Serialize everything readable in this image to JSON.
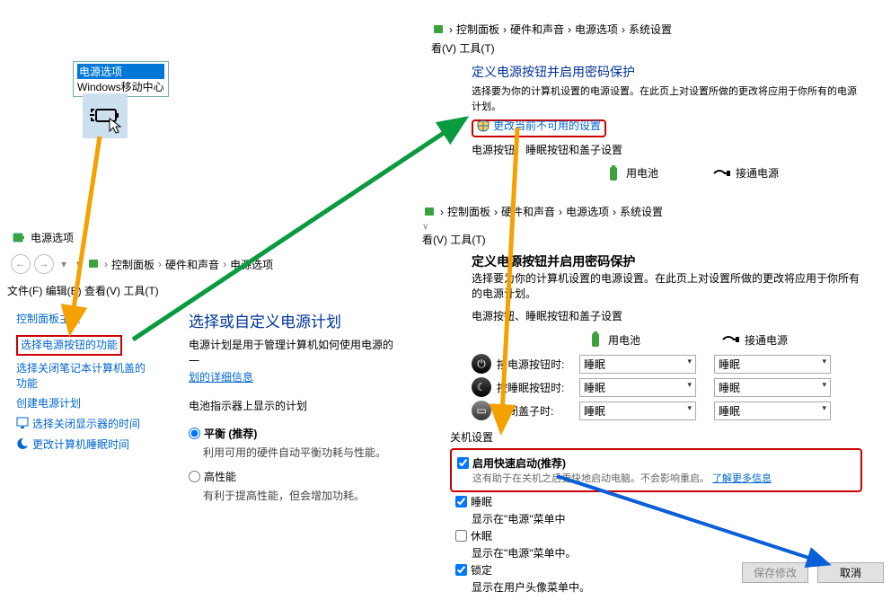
{
  "tl_menu": {
    "item1": "电源选项",
    "item2": "Windows移动中心"
  },
  "left": {
    "iconrow_label": "电源选项",
    "breadcrumb": [
      "控制面板",
      "硬件和声音",
      "电源选项"
    ],
    "menus": "文件(F)  编辑(E)  查看(V)  工具(T)",
    "sidebar": {
      "home": "控制面板主页",
      "links": [
        "选择电源按钮的功能",
        "选择关闭笔记本计算机盖的功能",
        "创建电源计划",
        "选择关闭显示器的时间",
        "更改计算机睡眠时间"
      ]
    },
    "main": {
      "title": "选择或自定义电源计划",
      "desc": "电源计划是用于管理计算机如何使用电源的一",
      "desc_link": "划的详细信息",
      "indicator_label": "电池指示器上显示的计划",
      "balanced": "平衡 (推荐)",
      "balanced_desc": "利用可用的硬件自动平衡功耗与性能。",
      "highperf": "高性能",
      "highperf_desc": "有利于提高性能，但会增加功耗。"
    }
  },
  "rt": {
    "breadcrumb": [
      "控制面板",
      "硬件和声音",
      "电源选项",
      "系统设置"
    ],
    "menus": "看(V)  工具(T)",
    "title": "定义电源按钮并启用密码保护",
    "desc": "选择要为你的计算机设置的电源设置。在此页上对设置所做的更改将应用于你所有的电源计划。",
    "change_link": "更改当前不可用的设置",
    "subline": "电源按钮、睡眠按钮和盖子设置",
    "col_battery": "用电池",
    "col_ac": "接通电源"
  },
  "rb": {
    "breadcrumb": [
      "控制面板",
      "硬件和声音",
      "电源选项",
      "系统设置"
    ],
    "menus": "看(V)  工具(T)",
    "title": "定义电源按钮并启用密码保护",
    "desc": "选择要为你的计算机设置的电源设置。在此页上对设置所做的更改将应用于你所有的电源计划。",
    "subline": "电源按钮、睡眠按钮和盖子设置",
    "col_battery": "用电池",
    "col_ac": "接通电源",
    "rows": [
      {
        "label": "按电源按钮时:",
        "v": "睡眠"
      },
      {
        "label": "按睡眠按钮时:",
        "v": "睡眠"
      },
      {
        "label": "关闭盖子时:",
        "v": "睡眠"
      }
    ],
    "shutdown_title": "关机设置",
    "fast_start": "启用快速启动(推荐)",
    "fast_start_desc_pre": "这有助于在关机之后更快地启动电脑。不会影响重启。",
    "fast_start_link": "了解更多信息",
    "sleep": "睡眠",
    "sleep_desc": "显示在\"电源\"菜单中",
    "hibernate": "休眠",
    "hibernate_desc": "显示在\"电源\"菜单中。",
    "lock": "锁定",
    "lock_desc": "显示在用户头像菜单中。",
    "save": "保存修改",
    "cancel": "取消"
  }
}
